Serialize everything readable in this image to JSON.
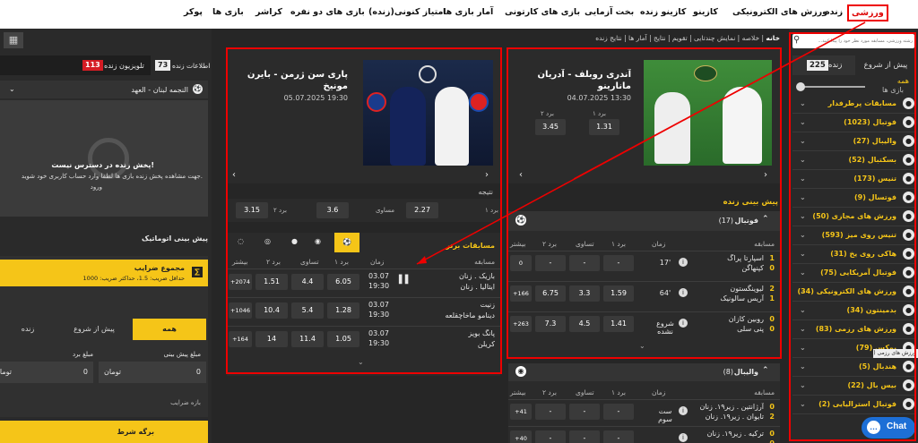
{
  "nav": {
    "items": [
      "ورزشی",
      "زنده",
      "ورزش های الکترونیکی",
      "کازینو",
      "کازینو زنده",
      "بخت آزمایی",
      "بازی های کارتونی",
      "آمار بازی ها",
      "امتیاز کنونی(زنده)",
      "بازی های دو نفره",
      "کراشر",
      "بازی ها",
      "پوکر"
    ]
  },
  "breadcrumb": [
    "خانه",
    "خلاصه",
    "نمایش چندتایی",
    "تقویم",
    "نتایج",
    "آمار ها",
    "نتایج زنده"
  ],
  "sidebar": {
    "search_placeholder": "رشته ورزشی، مسابقه مورد نظر خود را پیدا کنید...",
    "tab_live": "زنده",
    "tab_live_count": "225",
    "tab_prematch": "پیش از شروع",
    "all_label": "همه",
    "all_sub": "بازی ها",
    "sports": [
      {
        "label": "مسابقات پرطرفدار",
        "icon": "trophy-icon"
      },
      {
        "label": "فوتبال (1023)",
        "icon": "football-icon"
      },
      {
        "label": "والیبال (27)",
        "icon": "volleyball-icon"
      },
      {
        "label": "بسکتبال (52)",
        "icon": "basketball-icon"
      },
      {
        "label": "تنیس (173)",
        "icon": "tennis-icon"
      },
      {
        "label": "فوتسال (9)",
        "icon": "futsal-icon"
      },
      {
        "label": "ورزش های مجازی (50)",
        "icon": "virtual-icon"
      },
      {
        "label": "تنیس روی میز (593)",
        "icon": "table-tennis-icon"
      },
      {
        "label": "هاکی روی یخ (31)",
        "icon": "ice-hockey-icon"
      },
      {
        "label": "فوتبال آمریکایی (75)",
        "icon": "american-football-icon"
      },
      {
        "label": "ورزش های الکترونیکی (34)",
        "icon": "esports-icon"
      },
      {
        "label": "بدمینتون (34)",
        "icon": "badminton-icon"
      },
      {
        "label": "ورزش های رزمی (83)",
        "icon": "martial-arts-icon"
      },
      {
        "label": "بوکس (79)",
        "icon": "boxing-icon"
      },
      {
        "label": "هندبال (5)",
        "icon": "handball-icon"
      },
      {
        "label": "بیس بال (22)",
        "icon": "baseball-icon"
      },
      {
        "label": "فوتبال استرالیایی (2)",
        "icon": "aussie-football-icon"
      }
    ],
    "tooltip": "ورزش های رزمی (83)"
  },
  "featured1": {
    "title": "آندری روبلف - آدریان مانارینو",
    "datetime": "04.07.2025 13:30",
    "w1_label": "برد ۱",
    "w2_label": "برد ۲",
    "w1": "1.31",
    "w2": "3.45"
  },
  "featured2": {
    "title": "پاری سن ژرمن - بایرن مونیخ",
    "datetime": "05.07.2025 19:30",
    "result_label": "نتیجه",
    "w1_label": "برد ۱",
    "x_label": "مساوی",
    "w2_label": "برد ۲",
    "w1": "2.27",
    "x": "3.6",
    "w2": "3.15"
  },
  "live": {
    "section_title": "پیش بینی زنده",
    "football": {
      "title": "فوتبال",
      "count": "(17)",
      "headers": {
        "match": "مسابقه",
        "time": "زمان",
        "w1": "برد ۱",
        "x": "تساوی",
        "w2": "برد ۲",
        "more": "بیشتر"
      },
      "rows": [
        {
          "s1": "1",
          "s2": "0",
          "t1": "اسپارتا پراگ",
          "t2": "کپنهاگن",
          "time": "17'",
          "w1": "-",
          "x": "-",
          "w2": "-",
          "more": "0"
        },
        {
          "s1": "2",
          "s2": "1",
          "t1": "لیوینگستون",
          "t2": "آریس سالونیک",
          "time": "64'",
          "w1": "1.59",
          "x": "3.3",
          "w2": "6.75",
          "more": "+166"
        },
        {
          "s1": "0",
          "s2": "0",
          "t1": "روبین کازان",
          "t2": "پنی سلی",
          "time": "شروع نشده",
          "w1": "1.41",
          "x": "4.5",
          "w2": "7.3",
          "more": "+263"
        }
      ]
    },
    "volleyball": {
      "title": "والیبال",
      "count": "(8)",
      "rows": [
        {
          "s1": "0",
          "s2": "2",
          "t1": "آرژانتین . زیر۱۹. زنان",
          "t2": "تایوان . زیر۱۹. زنان",
          "time": "ست سوم",
          "w1": "-",
          "x": "-",
          "w2": "-",
          "more": "+41"
        },
        {
          "s1": "0",
          "s2": "0",
          "t1": "ترکیه . زیر۱۹. زنان",
          "t2": "",
          "time": "",
          "w1": "-",
          "x": "-",
          "w2": "-",
          "more": "+40"
        }
      ]
    }
  },
  "top": {
    "section_title": "مسابقات برتر",
    "headers": {
      "match": "مسابقه",
      "time": "زمان",
      "w1": "برد ۱",
      "x": "تساوی",
      "w2": "برد ۲",
      "more": "بیشتر"
    },
    "rows": [
      {
        "t1": "بازیک . زنان",
        "t2": "ایتالیا . زنان",
        "date": "03.07",
        "hour": "19:30",
        "w1": "6.05",
        "x": "4.4",
        "w2": "1.51",
        "more": "+2074"
      },
      {
        "t1": "زنیت",
        "t2": "دینامو ماخاچقلعه",
        "date": "03.07",
        "hour": "19:30",
        "w1": "1.28",
        "x": "5.4",
        "w2": "10.4",
        "more": "+1046"
      },
      {
        "t1": "پانگ بویز",
        "t2": "کریلن",
        "date": "03.07",
        "hour": "19:30",
        "w1": "1.05",
        "x": "11.4",
        "w2": "14",
        "more": "+164"
      }
    ]
  },
  "right": {
    "tab_stats": "اطلاعات زنده",
    "tab_stats_count": "73",
    "tab_tv": "تلویزیون زنده",
    "tab_tv_count": "113",
    "select_value": "النجمه لبنان - العهد",
    "unavail_title": "پخش زنده در دسترس نیست!",
    "unavail_text": "جهت مشاهده پخش زنده بازی ها لطفا وارد حساب کاربری خود شوید.",
    "unavail_link": "ورود",
    "auto_title": "پیش بینی اتوماتیک",
    "coef_title": "مجموع ضرایب",
    "coef_sub": "حداقل ضریب: 1.5، حداکثر ضریب: 1000",
    "tabs": [
      "همه",
      "پیش از شروع",
      "زنده"
    ],
    "stake_label": "مبلغ پیش بینی",
    "win_label": "مبلغ برد",
    "currency": "تومان",
    "zero": "0",
    "range_label": "بازه ضرایب",
    "slip": "برگه شرط",
    "chat": "Chat"
  }
}
